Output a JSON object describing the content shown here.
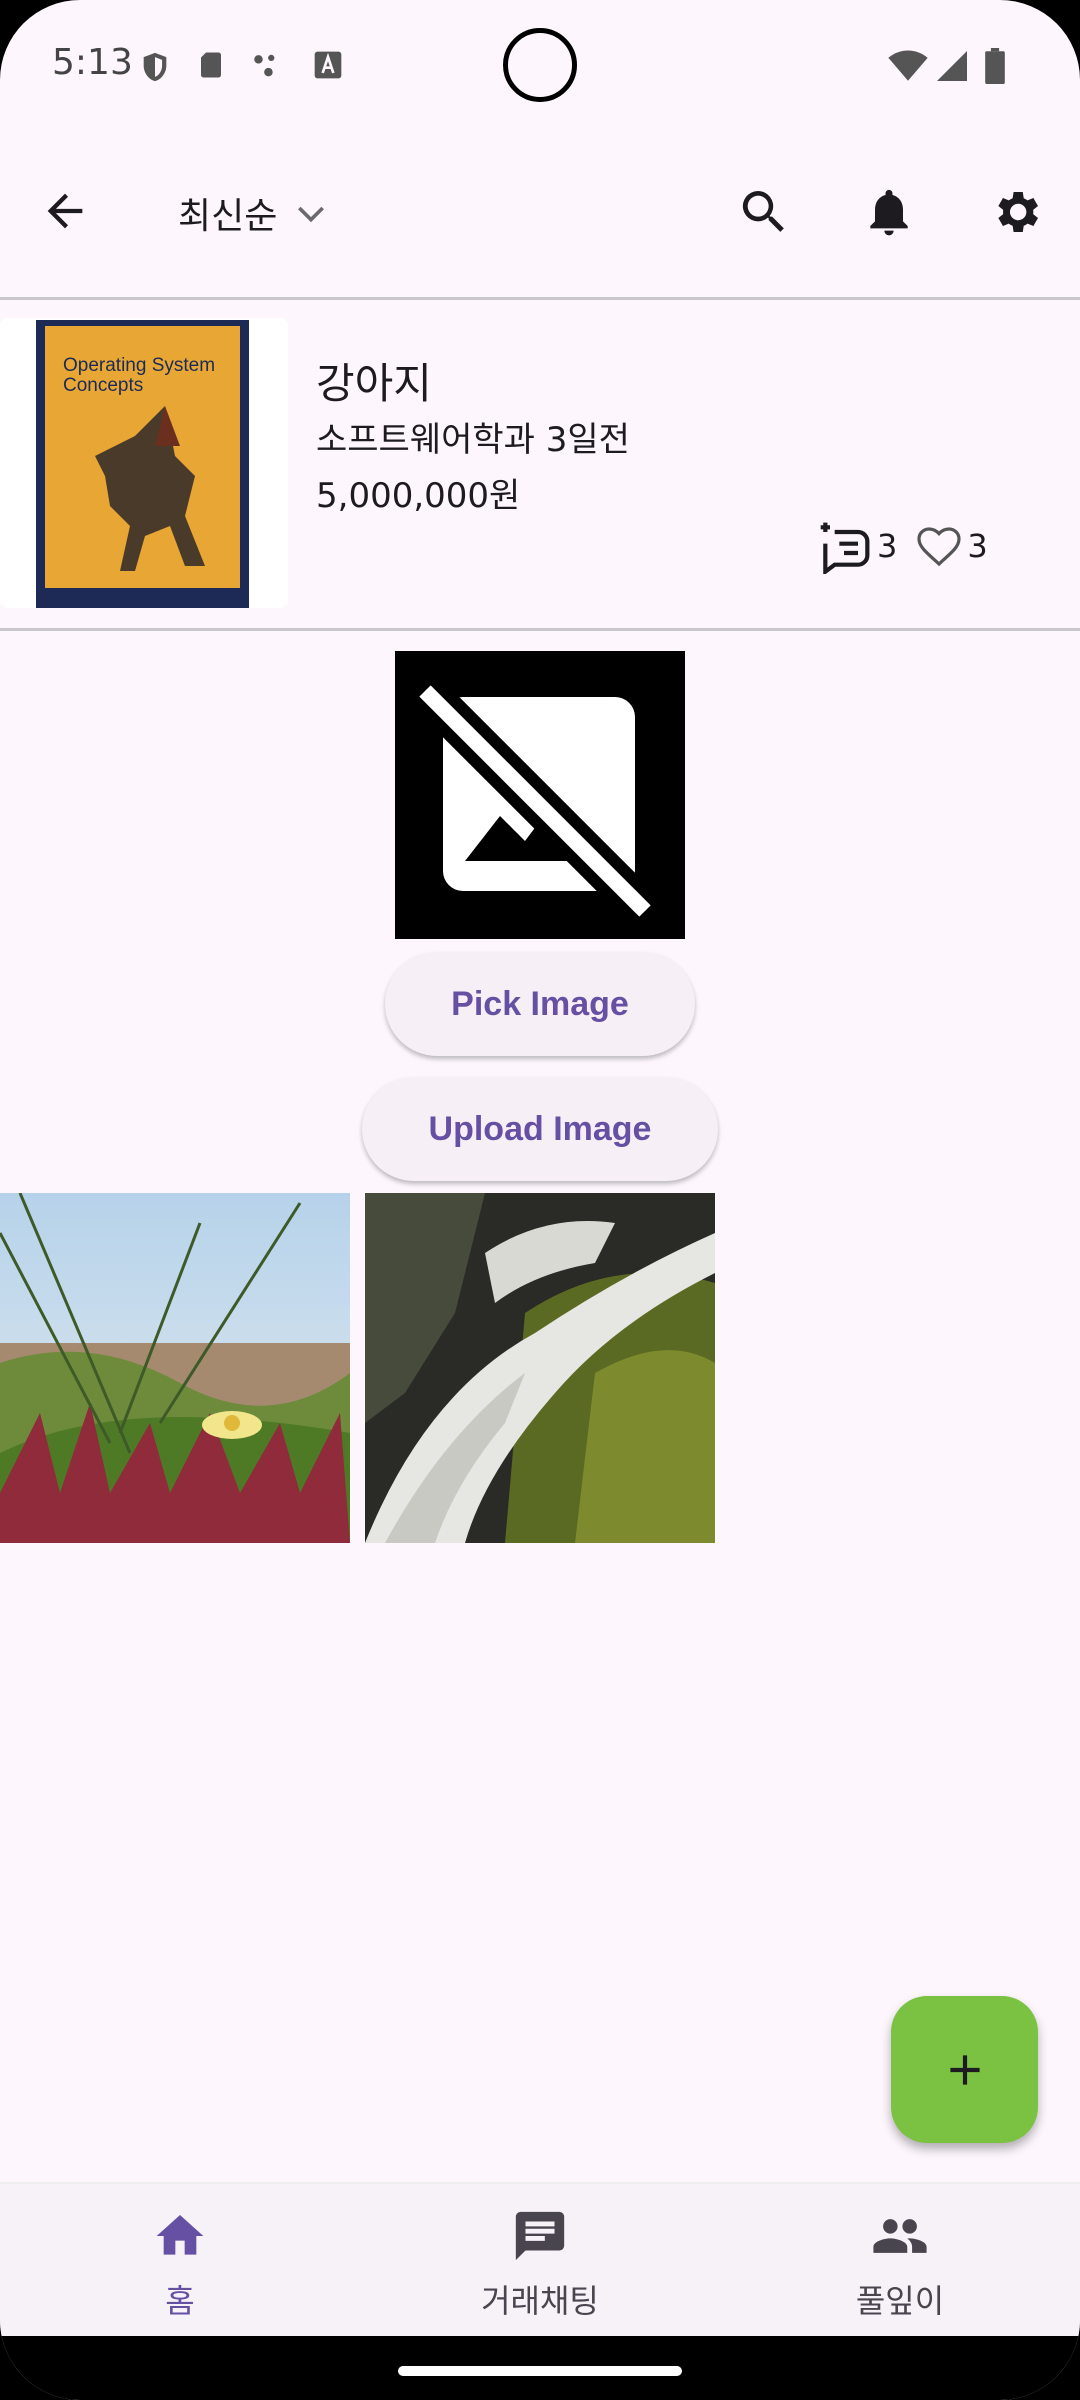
{
  "status_bar": {
    "time": "5:13"
  },
  "top_bar": {
    "sort_label": "최신순"
  },
  "listing": {
    "title": "강아지",
    "meta": "소프트웨어학과 3일전",
    "price": "5,000,000원",
    "book_cover_text": "Operating System Concepts",
    "chat_count": "3",
    "like_count": "3"
  },
  "image_picker": {
    "pick_label": "Pick Image",
    "upload_label": "Upload Image"
  },
  "bottom_nav": {
    "items": [
      {
        "label": "홈",
        "icon": "home-icon",
        "active": true
      },
      {
        "label": "거래채팅",
        "icon": "chat-icon",
        "active": false
      },
      {
        "label": "풀잎이",
        "icon": "people-icon",
        "active": false
      }
    ]
  },
  "colors": {
    "background": "#fdf7fd",
    "accent": "#6650a4",
    "fab": "#7bc142"
  }
}
